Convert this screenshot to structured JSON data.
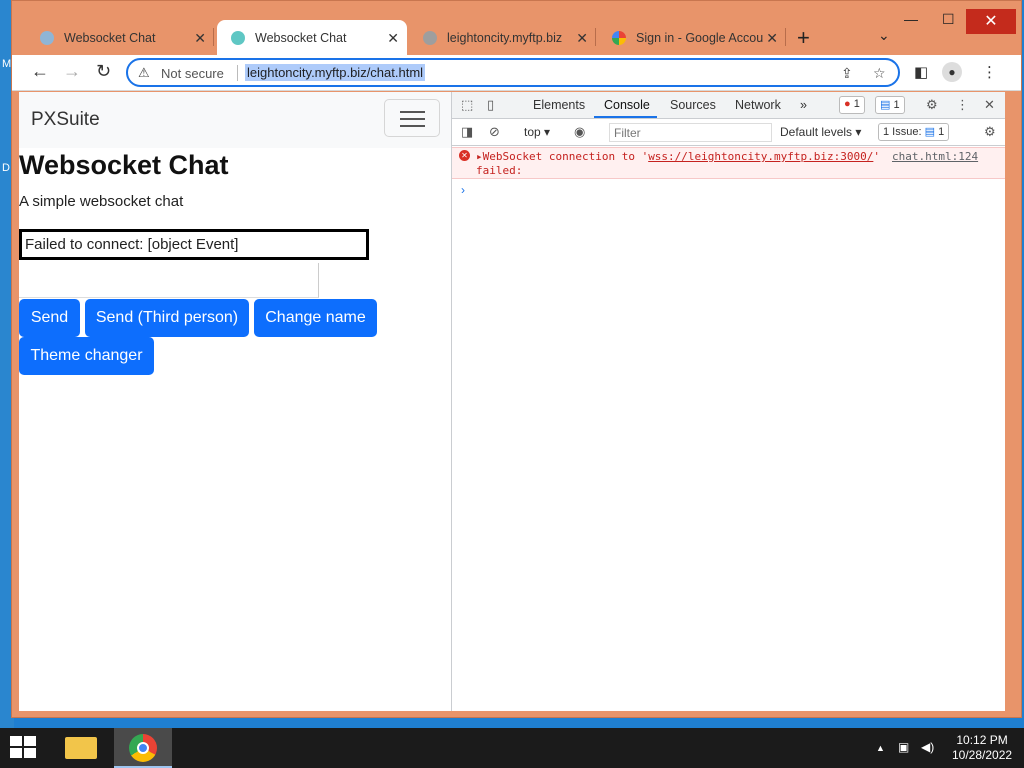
{
  "desktop": {
    "edge_letters": [
      "M",
      "D"
    ]
  },
  "browser": {
    "tabs": [
      {
        "title": "Websocket Chat",
        "active": false
      },
      {
        "title": "Websocket Chat",
        "active": true
      },
      {
        "title": "leightoncity.myftp.biz",
        "active": false
      },
      {
        "title": "Sign in - Google Accou",
        "active": false
      }
    ],
    "new_tab": "+",
    "tab_search": "⌄",
    "window_controls": {
      "minimize": "—",
      "maximize": "☐",
      "close": "✕"
    },
    "nav": {
      "back": "←",
      "forward": "→",
      "reload": "↻"
    },
    "omnibox": {
      "security_label": "Not secure",
      "url": "leightoncity.myftp.biz/chat.html"
    }
  },
  "page": {
    "brand": "PXSuite",
    "title": "Websocket Chat",
    "subtitle": "A simple websocket chat",
    "status": "Failed to connect: [object Event]",
    "message_input": {
      "value": "",
      "placeholder": ""
    },
    "buttons": {
      "send": "Send",
      "send_third": "Send (Third person)",
      "change_name": "Change name",
      "theme": "Theme changer"
    },
    "button_color": "#0d6efd"
  },
  "devtools": {
    "tabs": [
      "Elements",
      "Console",
      "Sources",
      "Network"
    ],
    "active_tab": "Console",
    "more_tabs": "»",
    "error_count": "1",
    "message_count": "1",
    "context": "top",
    "filter_placeholder": "Filter",
    "levels": "Default levels",
    "issues_label": "1 Issue:",
    "issues_count": "1",
    "error": {
      "prefix": "▸WebSocket connection to '",
      "url": "wss://leightoncity.myftp.biz:3000/",
      "suffix": "'",
      "line2": "failed:",
      "source": "chat.html:124"
    },
    "prompt": "›"
  },
  "taskbar": {
    "time": "10:12 PM",
    "date": "10/28/2022",
    "tray_caret": "▲"
  }
}
